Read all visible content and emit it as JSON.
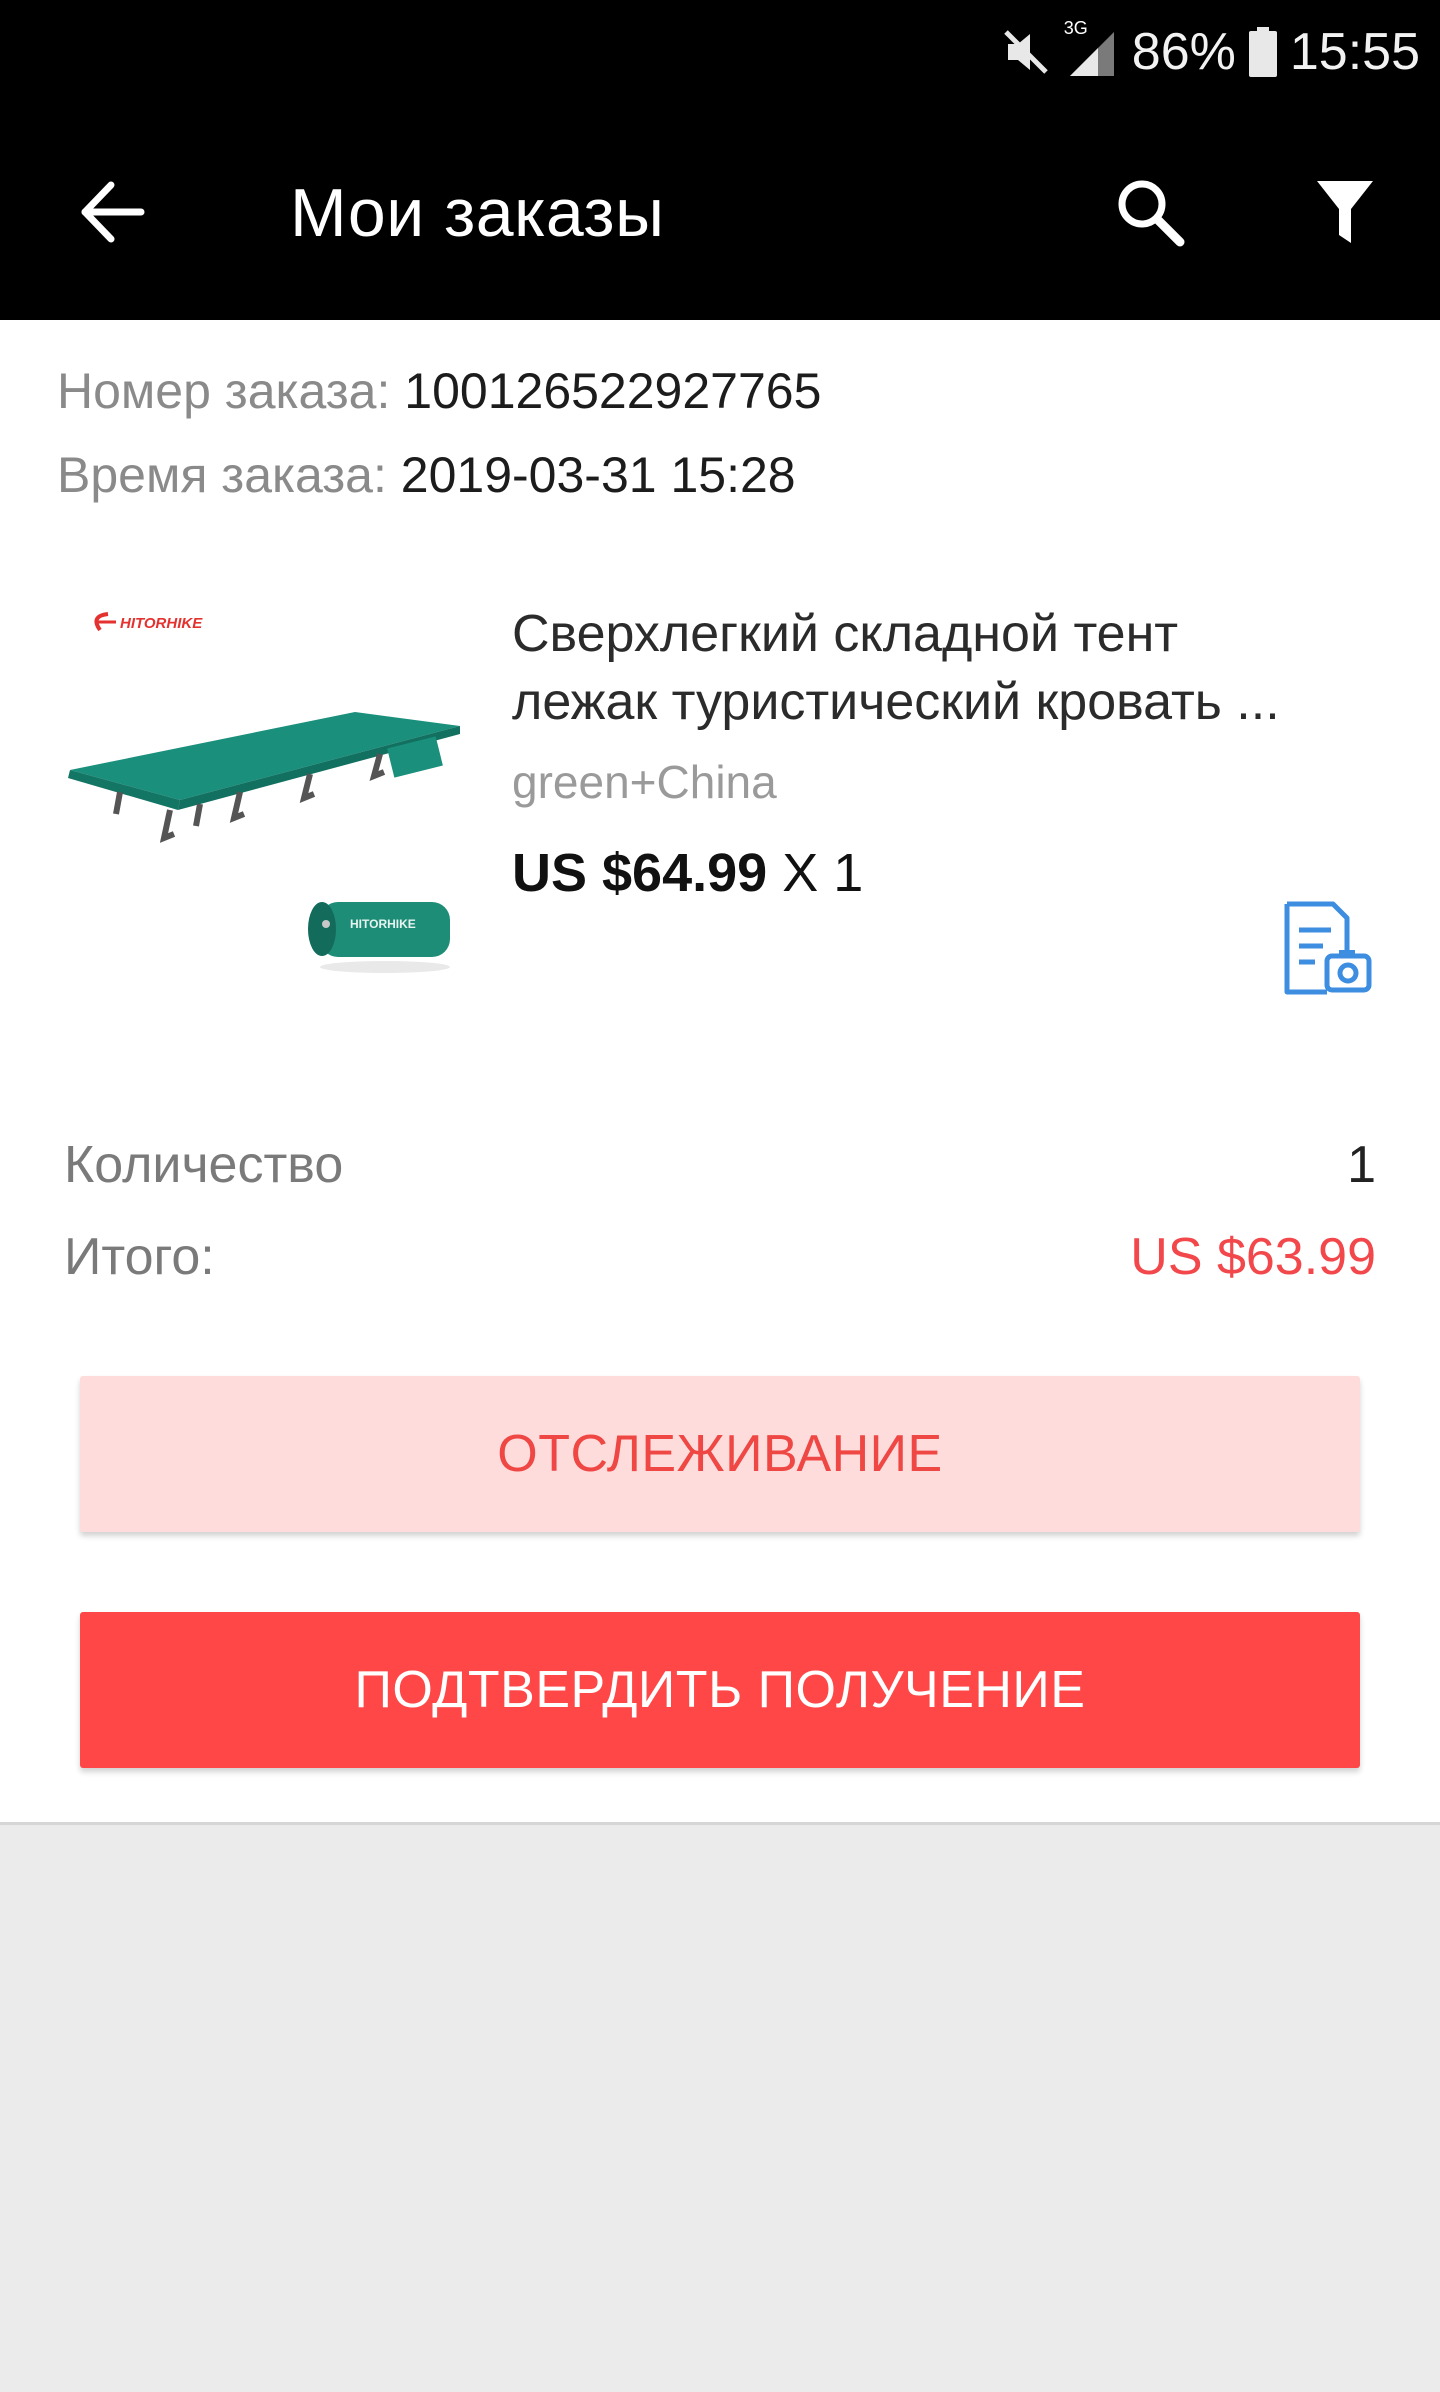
{
  "status_bar": {
    "network": "3G",
    "battery": "86%",
    "time": "15:55"
  },
  "toolbar": {
    "title": "Мои заказы",
    "icons": [
      "arrow-back-icon",
      "search-icon",
      "filter-icon"
    ]
  },
  "order": {
    "number_label": "Номер заказа:",
    "number_value": "100126522927765",
    "time_label": "Время заказа:",
    "time_value": "2019-03-31 15:28"
  },
  "product": {
    "brand": "HITORHIKE",
    "bag_brand": "HITORHIKE",
    "title_line1": "Сверхлегкий складной тент",
    "title_line2": "лежак туристический кровать ...",
    "variant": "green+China",
    "price": "US $64.99",
    "quantity_text": "X 1"
  },
  "summary": {
    "quantity_label": "Количество",
    "quantity_value": "1",
    "total_label": "Итого:",
    "total_value": "US $63.99"
  },
  "actions": {
    "track_label": "ОТСЛЕЖИВАНИЕ",
    "confirm_label": "ПОДТВЕРДИТЬ ПОЛУЧЕНИЕ"
  },
  "colors": {
    "accent": "#ff4747",
    "accent_light": "#ffdcdc",
    "total_red": "#f2484b",
    "link_blue": "#3d8de0"
  }
}
